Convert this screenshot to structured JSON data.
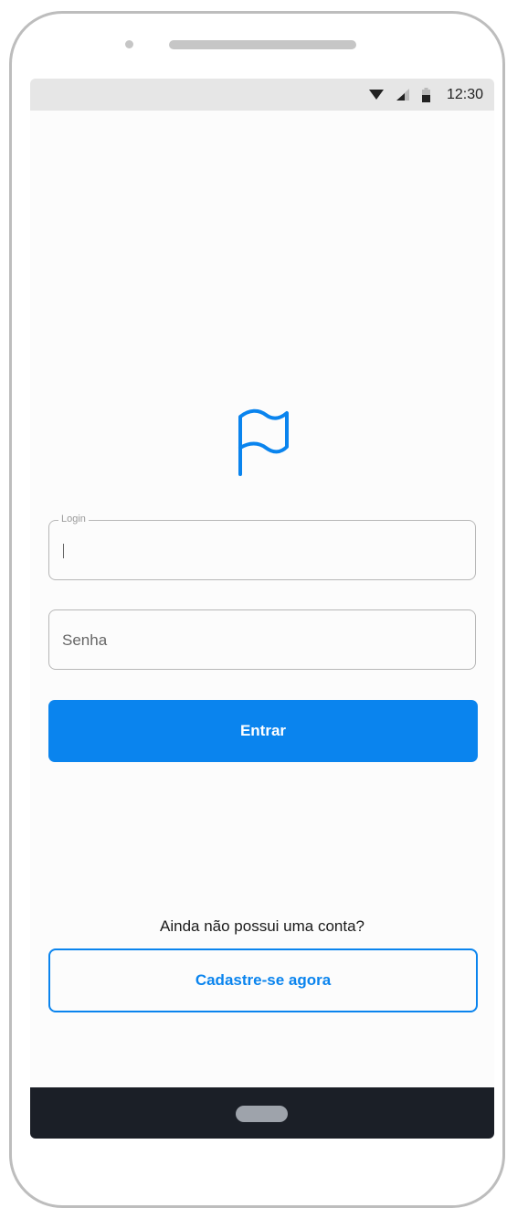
{
  "status_bar": {
    "time": "12:30",
    "icons": [
      "wifi-icon",
      "signal-icon",
      "battery-icon"
    ]
  },
  "logo": {
    "icon": "flag-icon",
    "color": "#0a84ee"
  },
  "form": {
    "login_label": "Login",
    "login_value": "",
    "password_placeholder": "Senha",
    "submit_label": "Entrar"
  },
  "signup": {
    "prompt": "Ainda não possui uma conta?",
    "button_label": "Cadastre-se agora"
  },
  "colors": {
    "primary": "#0a84ee",
    "nav_bar": "#1b1f27",
    "status_bar": "#e6e6e6"
  }
}
